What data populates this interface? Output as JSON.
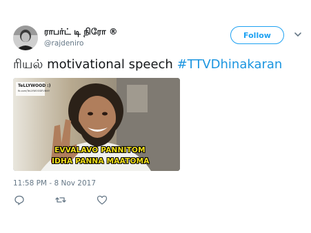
{
  "user": {
    "display_name": "ராபர்ட் டி நிரோ",
    "verified_mark": "®",
    "handle": "@rajdeniro"
  },
  "follow_label": "Follow",
  "tweet": {
    "text_tamil": "ரியல்",
    "text_mid": " motivational speech ",
    "hashtag": "#TTVDhinakaran"
  },
  "media": {
    "brand": "TeLLYWOOD :)",
    "brand_handle": "fb.com/TeLLYWOODFUNNY",
    "caption_line1": "EVVALAVO PANNITOM",
    "caption_line2": "IDHA PANNA MAATOMA"
  },
  "timestamp": "11:58 PM - 8 Nov 2017",
  "actions": [
    "reply-icon",
    "retweet-icon",
    "like-icon"
  ],
  "colors": {
    "accent": "#1da1f2",
    "hashtag": "#1b95e0",
    "muted": "#657786",
    "caption": "#f5e21b"
  }
}
